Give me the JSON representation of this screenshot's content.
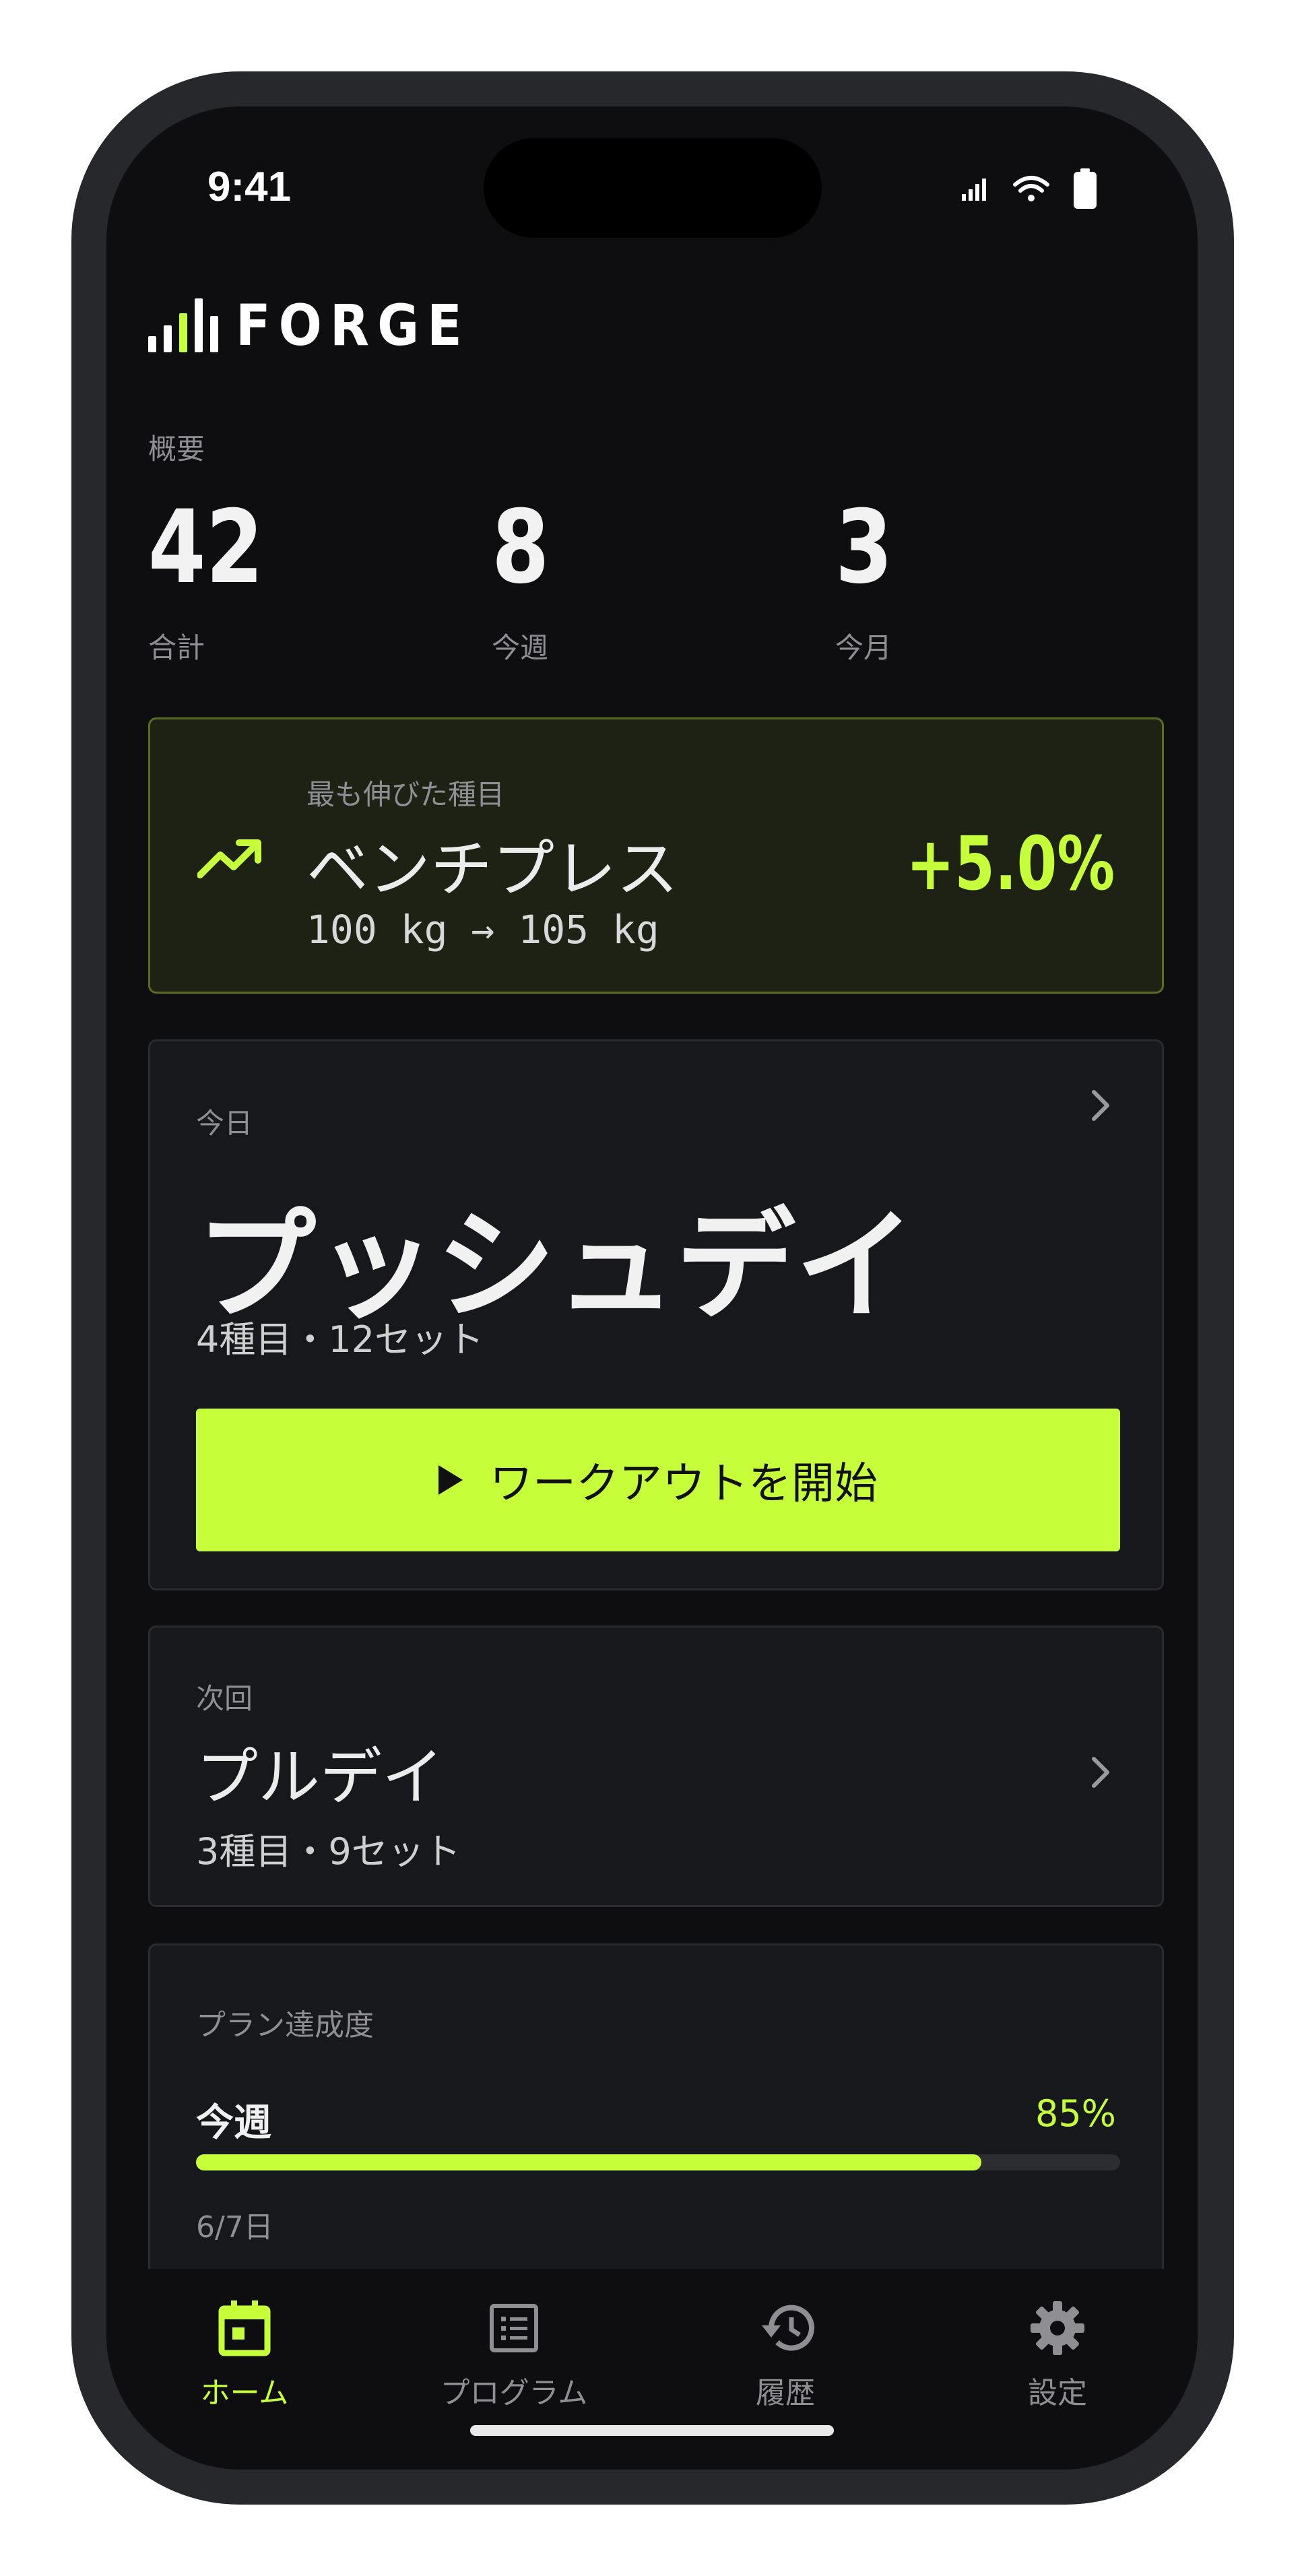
{
  "status_bar": {
    "time": "9:41"
  },
  "app": {
    "name": "FORGE"
  },
  "overview": {
    "title": "概要",
    "stats": [
      {
        "value": "42",
        "label": "合計"
      },
      {
        "value": "8",
        "label": "今週"
      },
      {
        "value": "3",
        "label": "今月"
      }
    ]
  },
  "highlight": {
    "label": "最も伸びた種目",
    "exercise": "ベンチプレス",
    "detail": "100 kg → 105 kg",
    "change": "+5.0%"
  },
  "today": {
    "label": "今日",
    "title": "プッシュデイ",
    "subtitle": "4種目・12セット",
    "start_label": "ワークアウトを開始"
  },
  "next": {
    "label": "次回",
    "title": "プルデイ",
    "subtitle": "3種目・9セット"
  },
  "plan": {
    "label": "プラン達成度",
    "period": "今週",
    "percent": "85%",
    "progress": 0.85,
    "days": "6/7日"
  },
  "tabs": [
    {
      "label": "ホーム",
      "icon": "calendar-icon",
      "active": true
    },
    {
      "label": "プログラム",
      "icon": "list-icon",
      "active": false
    },
    {
      "label": "履歴",
      "icon": "history-icon",
      "active": false
    },
    {
      "label": "設定",
      "icon": "gear-icon",
      "active": false
    }
  ],
  "colors": {
    "accent": "#c6ff3a",
    "background": "#0e0e10",
    "card": "#17181b"
  }
}
